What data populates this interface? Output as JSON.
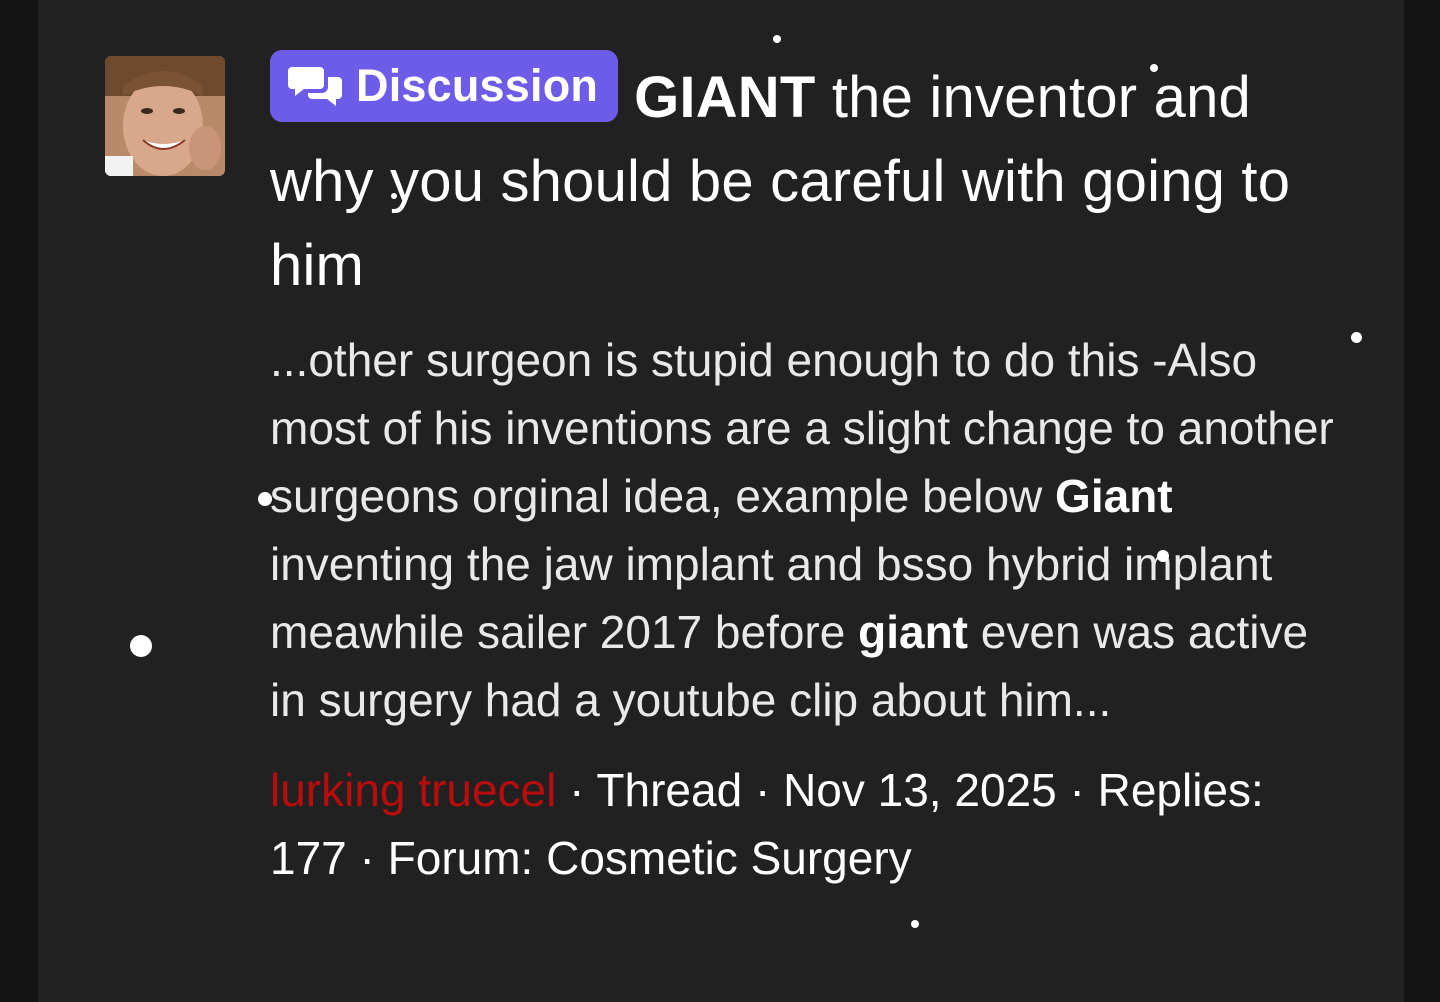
{
  "thread": {
    "prefix_label": "Discussion",
    "title_highlight": "GIANT",
    "title_rest": " the inventor and why you should be careful with going to him",
    "snippet": {
      "part1": "...other surgeon is stupid enough to do this -Also most of his inventions are a slight change to another surgeons orginal idea, example below ",
      "bold1": "Giant",
      "part2": " inventing the jaw implant and bsso hybrid implant meawhile sailer 2017 before ",
      "bold2": "giant",
      "part3": " even was active in surgery had a youtube clip about him..."
    },
    "author": "lurking truecel",
    "sep1": " · ",
    "type": "Thread",
    "sep2": " · ",
    "date": "Nov 13, 2025",
    "sep3": " · ",
    "replies": "Replies: 177",
    "sep4": " · ",
    "forum": "Forum: Cosmetic Surgery"
  },
  "icons": {
    "badge_icon": "chat-bubbles-icon",
    "avatar": "user-avatar"
  },
  "colors": {
    "background": "#212121",
    "badge": "#6c5ce7",
    "author": "#b90d0d",
    "text": "#ffffff"
  }
}
